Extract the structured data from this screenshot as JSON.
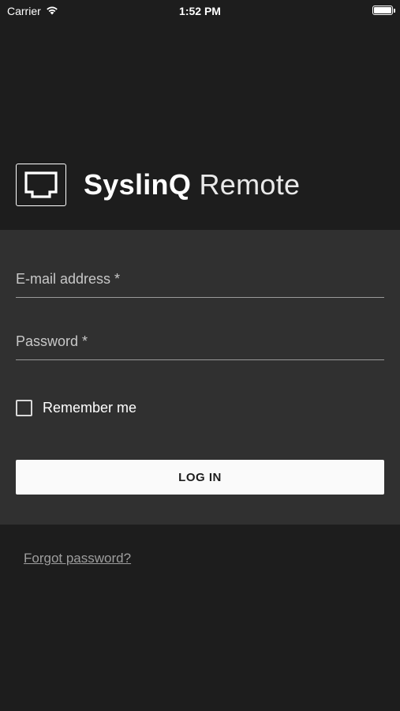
{
  "status_bar": {
    "carrier": "Carrier",
    "time": "1:52 PM",
    "wifi_icon": "wifi-icon",
    "battery_icon": "battery-icon"
  },
  "brand": {
    "logo_icon": "monitor-logo-icon",
    "name_strong": "SyslinQ",
    "name_light": "Remote"
  },
  "login_form": {
    "email_placeholder": "E-mail address *",
    "email_value": "",
    "password_placeholder": "Password *",
    "password_value": "",
    "remember_label": "Remember me",
    "remember_checked": false,
    "login_label": "LOG IN"
  },
  "forgot_password": "Forgot password?",
  "colors": {
    "background": "#1d1d1d",
    "panel": "#303030",
    "button": "#fafafa",
    "link": "#9e9e9e"
  }
}
